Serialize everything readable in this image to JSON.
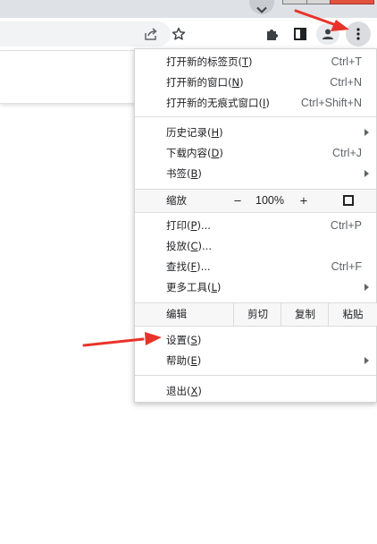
{
  "icons": {
    "tab_search": "chevron-down-icon",
    "share": "share-icon",
    "bookmark": "star-icon",
    "extensions": "puzzle-icon",
    "side_panel": "side-panel-icon",
    "profile": "person-icon",
    "menu": "three-dots-vertical-icon",
    "fullscreen": "fullscreen-icon",
    "submenu": "triangle-right-icon"
  },
  "colors": {
    "annotation_arrow": "#e8332a",
    "menu_background": "#ffffff",
    "highlight_row": "#f7f7f7",
    "close_button": "#e0533f"
  },
  "menu": {
    "new_tab": {
      "label": "打开新的标签页(",
      "key": "T",
      "end": ")",
      "shortcut": "Ctrl+T"
    },
    "new_window": {
      "label": "打开新的窗口(",
      "key": "N",
      "end": ")",
      "shortcut": "Ctrl+N"
    },
    "new_incognito": {
      "label": "打开新的无痕式窗口(",
      "key": "I",
      "end": ")",
      "shortcut": "Ctrl+Shift+N"
    },
    "history": {
      "label": "历史记录(",
      "key": "H",
      "end": ")"
    },
    "downloads": {
      "label": "下载内容(",
      "key": "D",
      "end": ")",
      "shortcut": "Ctrl+J"
    },
    "bookmarks": {
      "label": "书签(",
      "key": "B",
      "end": ")"
    },
    "zoom": {
      "label": "缩放",
      "minus": "−",
      "value": "100%",
      "plus": "+"
    },
    "print": {
      "label": "打印(",
      "key": "P",
      "end": ")...",
      "shortcut": "Ctrl+P"
    },
    "cast": {
      "label": "投放(",
      "key": "C",
      "end": ")..."
    },
    "find": {
      "label": "查找(",
      "key": "F",
      "end": ")...",
      "shortcut": "Ctrl+F"
    },
    "more_tools": {
      "label": "更多工具(",
      "key": "L",
      "end": ")"
    },
    "edit": {
      "label": "编辑",
      "cut": "剪切",
      "copy": "复制",
      "paste": "粘贴"
    },
    "settings": {
      "label": "设置(",
      "key": "S",
      "end": ")"
    },
    "help": {
      "label": "帮助(",
      "key": "E",
      "end": ")"
    },
    "exit": {
      "label": "退出(",
      "key": "X",
      "end": ")"
    }
  }
}
